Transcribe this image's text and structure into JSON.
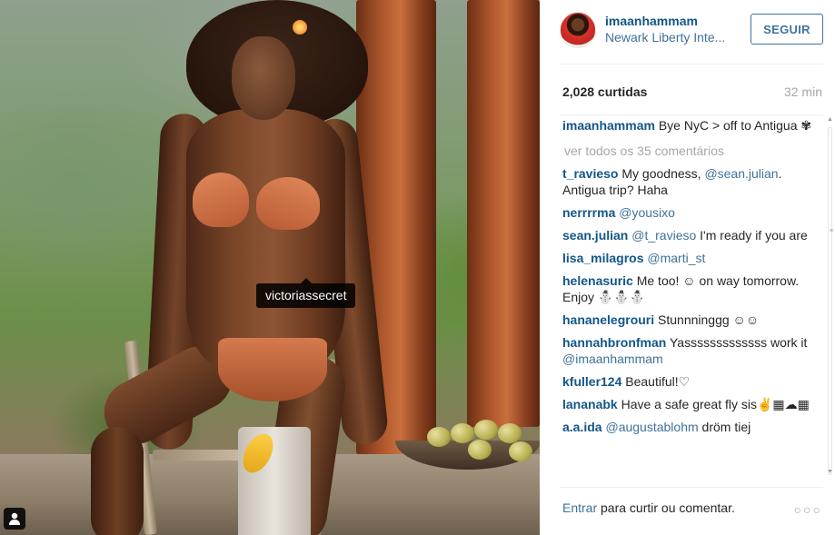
{
  "photo": {
    "product_tag": "victoriassecret"
  },
  "header": {
    "username": "imaanhammam",
    "location": "Newark Liberty Inte...",
    "follow_label": "SEGUIR"
  },
  "stats": {
    "likes": "2,028 curtidas",
    "time": "32 min"
  },
  "caption": {
    "user": "imaanhammam",
    "text": "Bye NyC > off to Antigua ✾"
  },
  "view_all": "ver todos os 35 comentários",
  "comments": [
    {
      "user": "t_ravieso",
      "pre": "My goodness, ",
      "mention": "@sean.julian",
      "post": ". Antigua trip? Haha"
    },
    {
      "user": "nerrrrma",
      "pre": "",
      "mention": "@yousixo",
      "post": ""
    },
    {
      "user": "sean.julian",
      "pre": "",
      "mention": "@t_ravieso",
      "post": " I'm ready if you are"
    },
    {
      "user": "lisa_milagros",
      "pre": "",
      "mention": "@marti_st",
      "post": ""
    },
    {
      "user": "helenasuric",
      "pre": "Me too! ☺ on way tomorrow. Enjoy ⛄⛄⛄",
      "mention": "",
      "post": ""
    },
    {
      "user": "hananelegrouri",
      "pre": "Stunnninggg ☺☺",
      "mention": "",
      "post": ""
    },
    {
      "user": "hannahbronfman",
      "pre": "Yasssssssssssss work it ",
      "mention": "@imaanhammam",
      "post": ""
    },
    {
      "user": "kfuller124",
      "pre": "Beautiful!♡",
      "mention": "",
      "post": ""
    },
    {
      "user": "lananabk",
      "pre": "Have a safe great fly sis✌▦☁▦",
      "mention": "",
      "post": ""
    },
    {
      "user": "a.a.ida",
      "pre": "",
      "mention": "@augustablohm",
      "post": " dröm tiej"
    }
  ],
  "footer": {
    "login_link": "Entrar",
    "login_rest": " para curtir ou comentar.",
    "more": "○○○"
  },
  "icons": {
    "user_tag": "person-icon",
    "more": "more-options-icon"
  }
}
